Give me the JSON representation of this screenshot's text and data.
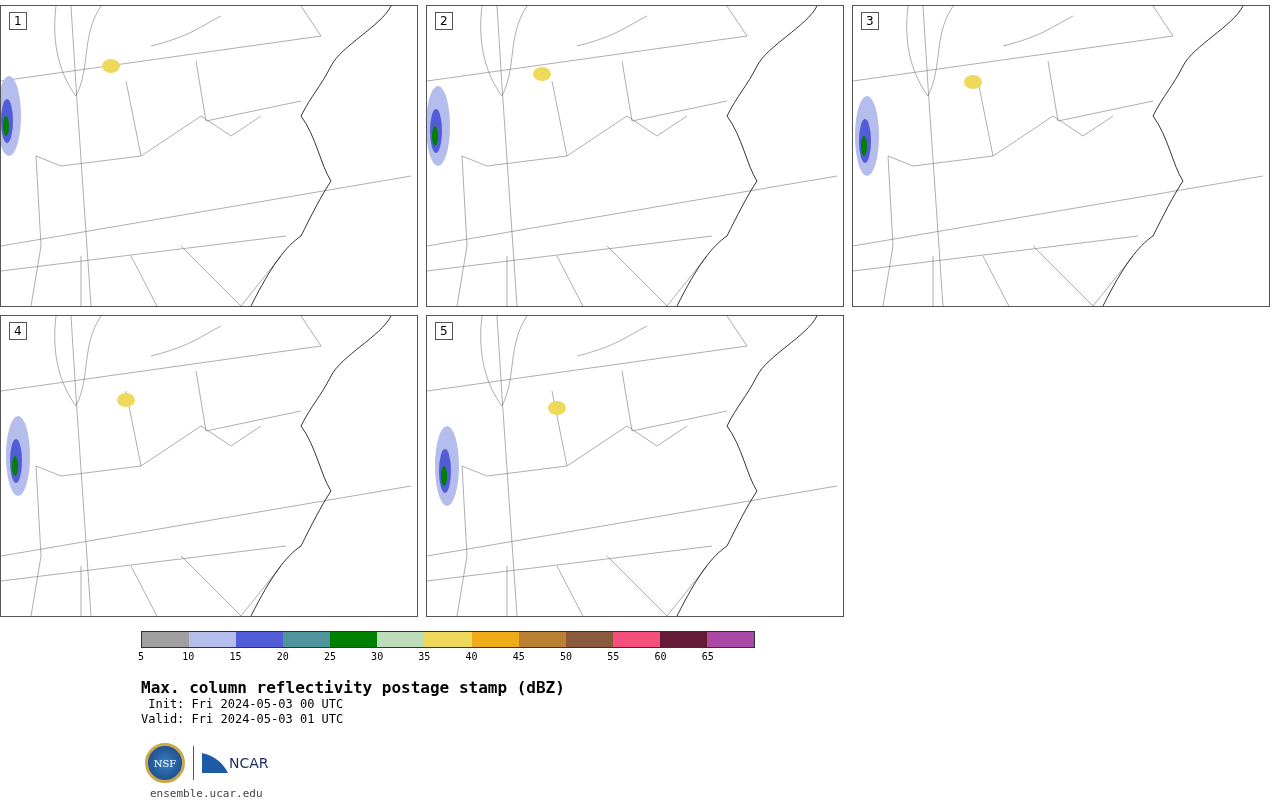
{
  "panels": [
    {
      "label": "1"
    },
    {
      "label": "2"
    },
    {
      "label": "3"
    },
    {
      "label": "4"
    },
    {
      "label": "5"
    }
  ],
  "colorbar": {
    "segments": [
      {
        "color": "#a0a0a0"
      },
      {
        "color": "#b4bdec"
      },
      {
        "color": "#525cd6"
      },
      {
        "color": "#4f959b"
      },
      {
        "color": "#008000"
      },
      {
        "color": "#bcdcbc"
      },
      {
        "color": "#eed95a"
      },
      {
        "color": "#efab18"
      },
      {
        "color": "#bb8133"
      },
      {
        "color": "#8b5a3c"
      },
      {
        "color": "#f3517c"
      },
      {
        "color": "#651a36"
      },
      {
        "color": "#ab4aa6"
      }
    ],
    "ticks": [
      "5",
      "10",
      "15",
      "20",
      "25",
      "30",
      "35",
      "40",
      "45",
      "50",
      "55",
      "60",
      "65"
    ]
  },
  "title": "Max. column reflectivity postage stamp (dBZ)",
  "init": " Init: Fri 2024-05-03 00 UTC",
  "valid": "Valid: Fri 2024-05-03 01 UTC",
  "logos": {
    "nsf": "NSF",
    "ncar": "NCAR"
  },
  "site": "ensemble.ucar.edu"
}
